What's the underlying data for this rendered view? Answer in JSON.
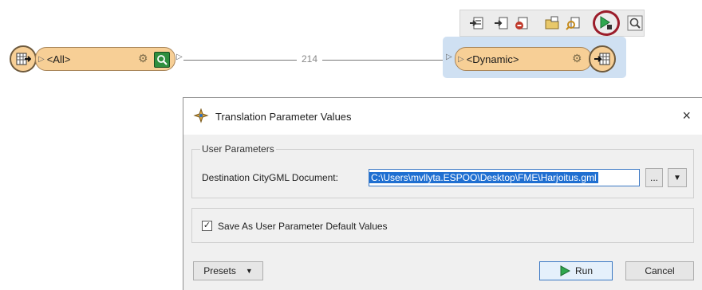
{
  "canvas": {
    "reader_node_label": "<All>",
    "writer_node_label": "<Dynamic>",
    "feature_count": "214",
    "toolbar_icons": [
      "import-icon",
      "export-icon",
      "remove-icon",
      "folder-icon",
      "inspect-icon",
      "run-to-this-icon",
      "zoom-icon"
    ]
  },
  "dialog": {
    "title": "Translation Parameter Values",
    "close_label": "×",
    "group_title": "User Parameters",
    "destination_label": "Destination CityGML Document:",
    "destination_value": "C:\\Users\\mvllyta.ESPOO\\Desktop\\FME\\Harjoitus.gml",
    "browse_label": "...",
    "dropdown_label": "▼",
    "save_default_checked": true,
    "save_default_label": "Save As User Parameter Default Values",
    "presets_label": "Presets",
    "run_label": "Run",
    "cancel_label": "Cancel"
  }
}
